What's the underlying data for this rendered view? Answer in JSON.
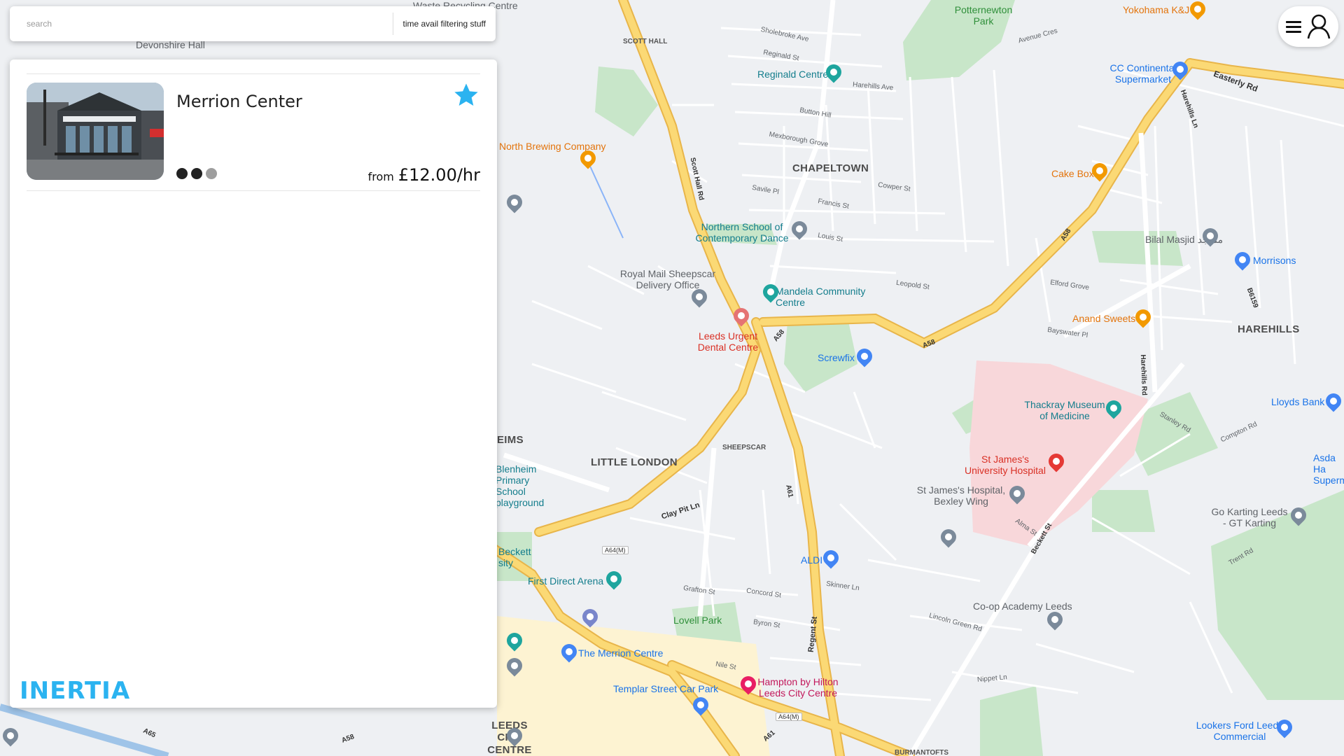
{
  "search": {
    "placeholder": "search",
    "value": "",
    "filter_label": "time avail filtering stuff"
  },
  "results": [
    {
      "name": "Merrion Center",
      "favorite": true,
      "rating": 2,
      "rating_max": 3,
      "price_prefix": "from",
      "price": "£12.00/hr"
    }
  ],
  "brand": {
    "logo_text": "INERTIA"
  },
  "header": {
    "menu_icon": "menu-icon",
    "user_icon": "user-icon"
  },
  "colors": {
    "brand": "#2bb3f0",
    "favorite_star": "#2bb3f0",
    "rating_on": "#222222",
    "rating_off": "#9e9e9e",
    "motorway": "#f7c85a",
    "park": "#c8e6c9",
    "hospital": "#f8d7da"
  },
  "map": {
    "districts": {
      "chapeltown": "CHAPELTOWN",
      "harehills": "HAREHILLS",
      "little_london": "LITTLE LONDON",
      "leeds_city_centre": "LEEDS CITY CENTRE",
      "sheepscar": "SHEEPSCAR",
      "scott_hall": "SCOTT HALL",
      "burmantofts": "BURMANTOFTS",
      "eims": "EIMS",
      "potternewton_park": "Potternewton Park"
    },
    "pois": {
      "devonshire_hall": "Devonshire Hall",
      "waste_recycling": "Waste Recycling Centre",
      "reginald_centre": "Reginald Centre",
      "north_brewing": "North Brewing Company",
      "northern_school": "Northern School of Contemporary Dance",
      "royal_mail": "Royal Mail Sheepscar Delivery Office",
      "mandela_centre": "Mandela Community Centre",
      "leeds_urgent_dental": "Leeds Urgent Dental Centre",
      "screwfix": "Screwfix",
      "cake_box": "Cake Box",
      "yokohama": "Yokohama K&J",
      "cc_continental": "CC Continental Supermarket",
      "bilal_masjid": "Bilal Masjid مسجد",
      "morrisons": "Morrisons",
      "anand_sweets": "Anand Sweets",
      "thackray_museum": "Thackray Museum of Medicine",
      "st_james_hospital": "St James's University Hospital",
      "st_james_bexley": "St James's Hospital, Bexley Wing",
      "lloyds_bank": "Lloyds Bank",
      "asda": "Asda Ha Superm",
      "go_karting": "Go Karting Leeds - GT Karting",
      "blenheim_school": "Blenheim Primary School playground",
      "leckett_city": "Beckett sity",
      "first_direct_arena": "First Direct Arena",
      "merrion_centre": "The Merrion Centre",
      "templar_street": "Templar Street Car Park",
      "lovell_park": "Lovell Park",
      "aldi": "ALDI",
      "hampton_hilton": "Hampton by Hilton Leeds City Centre",
      "coop_academy": "Co-op Academy Leeds",
      "lookers_ford": "Lookers Ford Leeds Commercial"
    },
    "streets": {
      "scott_hall_rd": "Scott Hall Rd",
      "easterly_rd": "Easterly Rd",
      "harehills_ln": "Harehills Ln",
      "harehills_rd": "Harehills Rd",
      "clay_pit_ln": "Clay Pit Ln",
      "regent_st": "Regent St",
      "beckett_st": "Beckett St",
      "a58_1": "A58",
      "a58_2": "A58",
      "a58_3": "A58",
      "a58_4": "A58",
      "a61_1": "A61",
      "a61_2": "A61",
      "a64m_1": "A64(M)",
      "a64m_2": "A64(M)",
      "a65": "A65",
      "b6159": "B6159",
      "avenue_cres": "Avenue Cres",
      "reginald_st": "Reginald St",
      "louis_st": "Louis St",
      "leopold_st": "Leopold St",
      "savile_pl": "Savile Pl",
      "francis_st": "Francis St",
      "elford_grove": "Elford Grove",
      "bayswater_pl": "Bayswater Pl",
      "skinner_ln": "Skinner Ln",
      "grafton_st": "Grafton St",
      "concord_st": "Concord St",
      "byron_st": "Byron St",
      "nile_st": "Nile St",
      "lincoln_green_rd": "Lincoln Green Rd",
      "nippet_ln": "Nippet Ln",
      "stanley_rd": "Stanley Rd",
      "compton_rd": "Compton Rd",
      "trent_rd": "Trent Rd",
      "alma_st": "Alma St",
      "cowper_st": "Cowper St",
      "harehills_ave": "Harehills Ave",
      "mexborough_grove": "Mexborough Grove",
      "shoobroke_ave": "Sholebroke Ave",
      "button_hill": "Button Hill"
    }
  }
}
